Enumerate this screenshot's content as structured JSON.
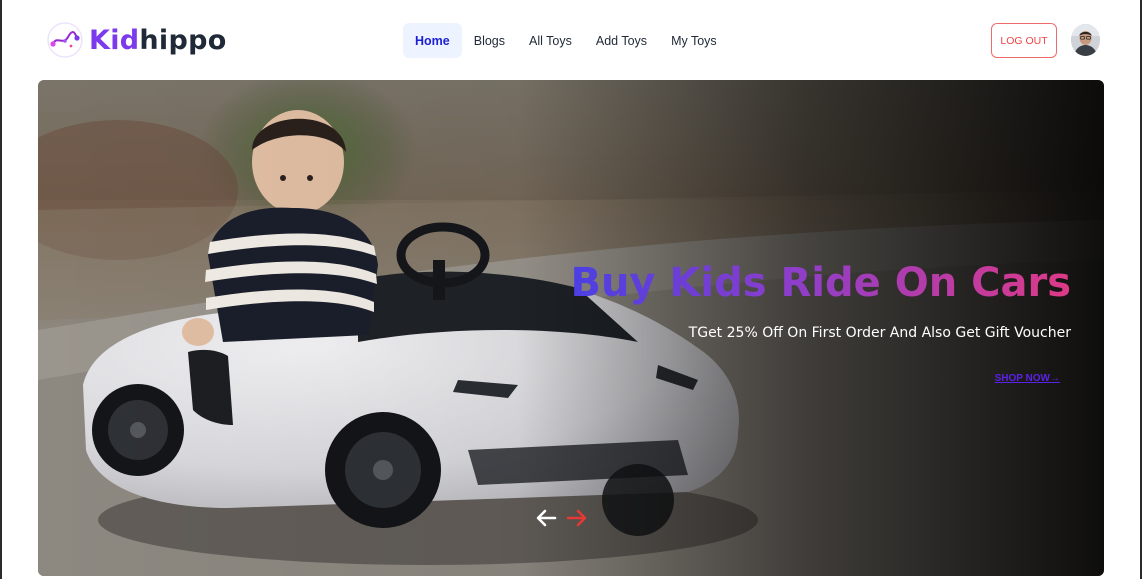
{
  "brand": {
    "name_part1": "Kid",
    "name_part2": "hippo",
    "colors": {
      "part1": "#7c3aed",
      "part2": "#1f2937"
    }
  },
  "nav": {
    "items": [
      {
        "label": "Home",
        "active": true
      },
      {
        "label": "Blogs",
        "active": false
      },
      {
        "label": "All Toys",
        "active": false
      },
      {
        "label": "Add Toys",
        "active": false
      },
      {
        "label": "My Toys",
        "active": false
      }
    ],
    "active_color": "#1d1fd4"
  },
  "header": {
    "logout_label": "LOG OUT",
    "logout_color": "#ef4444",
    "avatar_icon": "user-avatar-photo"
  },
  "hero": {
    "title": "Buy Kids Ride On Cars",
    "subtitle": "TGet 25% Off On First Order And Also Get Gift Voucher",
    "cta_label": "SHOP NOW",
    "cta_icon": "arrow-right-icon",
    "image": "child-driving-white-toy-sports-car",
    "prev_icon": "arrow-left-icon",
    "next_icon": "arrow-right-icon",
    "title_gradient": [
      "#4b3fe3",
      "#8e3ec9",
      "#de3a87"
    ],
    "next_arrow_color": "#e53935"
  }
}
